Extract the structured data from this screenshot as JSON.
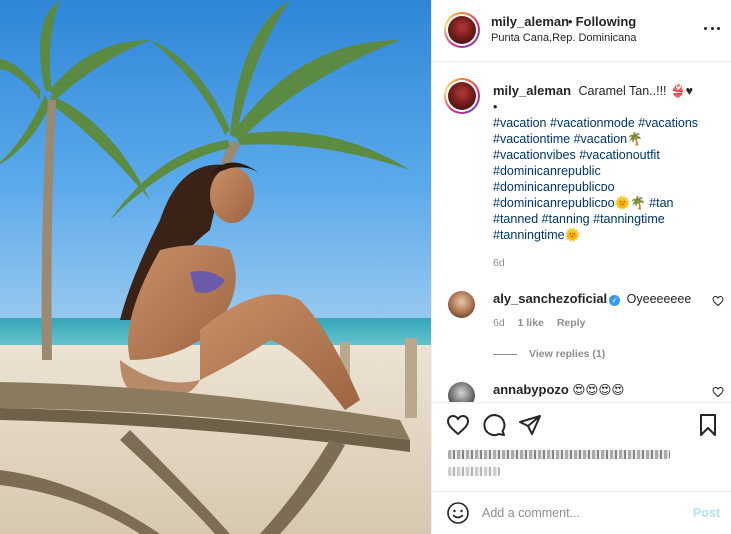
{
  "post": {
    "author": "mily_aleman",
    "follow_status": "Following",
    "location": "Punta Cana,Rep. Dominicana"
  },
  "caption": {
    "author": "mily_aleman",
    "text": "Caramel Tan..!!! 👙♥",
    "bullet": "•",
    "hashtags": [
      "#vacation",
      "#vacationmode",
      "#vacations",
      "#vacationtime",
      "#vacation🌴",
      "#vacationvibes",
      "#vacationoutfit",
      "#dominicanrepublic",
      "#dominicanrepublicᴅᴏ",
      "#dominicanrepublicᴅᴏ🌞🌴",
      "#tan",
      "#tanned",
      "#tanning",
      "#tanningtime",
      "#tanningtime🌞"
    ],
    "age": "6d"
  },
  "comments": [
    {
      "author": "aly_sanchezoficial",
      "verified": true,
      "text": "Oyeeeeeee",
      "age": "6d",
      "likes": "1 like",
      "reply_label": "Reply",
      "view_replies": "View replies (1)"
    },
    {
      "author": "annabypozo",
      "text": "😍😍😍😍"
    }
  ],
  "add_comment": {
    "placeholder": "Add a comment...",
    "post_label": "Post"
  },
  "icons": {
    "more": "more-horizontal-icon",
    "like": "heart-icon",
    "comment": "speech-bubble-icon",
    "share": "paper-plane-icon",
    "save": "bookmark-icon",
    "emoji": "smiley-icon"
  },
  "colors": {
    "link": "#00376b",
    "muted": "#8e8e8e",
    "post_disabled": "#b2dffc",
    "verified": "#3897f0"
  }
}
